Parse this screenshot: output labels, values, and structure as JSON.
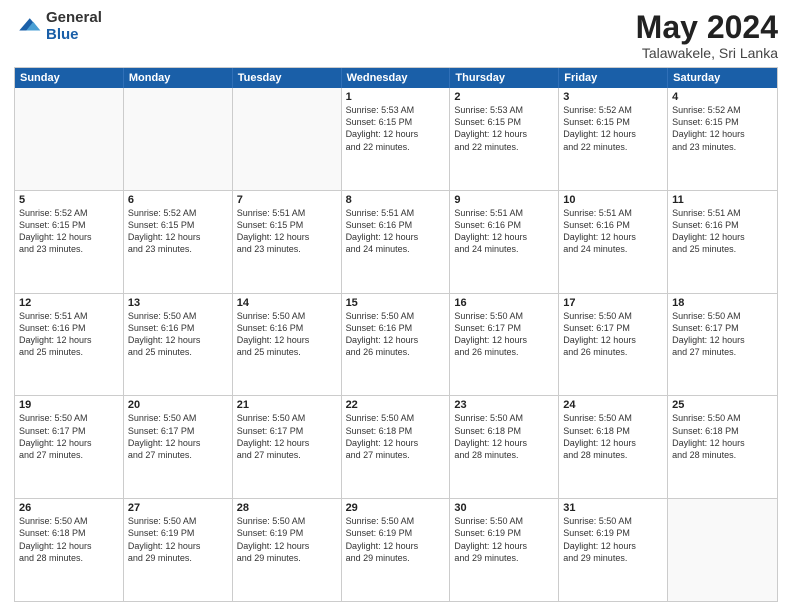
{
  "logo": {
    "general": "General",
    "blue": "Blue"
  },
  "title": {
    "month": "May 2024",
    "location": "Talawakele, Sri Lanka"
  },
  "days": [
    "Sunday",
    "Monday",
    "Tuesday",
    "Wednesday",
    "Thursday",
    "Friday",
    "Saturday"
  ],
  "weeks": [
    [
      {
        "day": "",
        "info": ""
      },
      {
        "day": "",
        "info": ""
      },
      {
        "day": "",
        "info": ""
      },
      {
        "day": "1",
        "info": "Sunrise: 5:53 AM\nSunset: 6:15 PM\nDaylight: 12 hours\nand 22 minutes."
      },
      {
        "day": "2",
        "info": "Sunrise: 5:53 AM\nSunset: 6:15 PM\nDaylight: 12 hours\nand 22 minutes."
      },
      {
        "day": "3",
        "info": "Sunrise: 5:52 AM\nSunset: 6:15 PM\nDaylight: 12 hours\nand 22 minutes."
      },
      {
        "day": "4",
        "info": "Sunrise: 5:52 AM\nSunset: 6:15 PM\nDaylight: 12 hours\nand 23 minutes."
      }
    ],
    [
      {
        "day": "5",
        "info": "Sunrise: 5:52 AM\nSunset: 6:15 PM\nDaylight: 12 hours\nand 23 minutes."
      },
      {
        "day": "6",
        "info": "Sunrise: 5:52 AM\nSunset: 6:15 PM\nDaylight: 12 hours\nand 23 minutes."
      },
      {
        "day": "7",
        "info": "Sunrise: 5:51 AM\nSunset: 6:15 PM\nDaylight: 12 hours\nand 23 minutes."
      },
      {
        "day": "8",
        "info": "Sunrise: 5:51 AM\nSunset: 6:16 PM\nDaylight: 12 hours\nand 24 minutes."
      },
      {
        "day": "9",
        "info": "Sunrise: 5:51 AM\nSunset: 6:16 PM\nDaylight: 12 hours\nand 24 minutes."
      },
      {
        "day": "10",
        "info": "Sunrise: 5:51 AM\nSunset: 6:16 PM\nDaylight: 12 hours\nand 24 minutes."
      },
      {
        "day": "11",
        "info": "Sunrise: 5:51 AM\nSunset: 6:16 PM\nDaylight: 12 hours\nand 25 minutes."
      }
    ],
    [
      {
        "day": "12",
        "info": "Sunrise: 5:51 AM\nSunset: 6:16 PM\nDaylight: 12 hours\nand 25 minutes."
      },
      {
        "day": "13",
        "info": "Sunrise: 5:50 AM\nSunset: 6:16 PM\nDaylight: 12 hours\nand 25 minutes."
      },
      {
        "day": "14",
        "info": "Sunrise: 5:50 AM\nSunset: 6:16 PM\nDaylight: 12 hours\nand 25 minutes."
      },
      {
        "day": "15",
        "info": "Sunrise: 5:50 AM\nSunset: 6:16 PM\nDaylight: 12 hours\nand 26 minutes."
      },
      {
        "day": "16",
        "info": "Sunrise: 5:50 AM\nSunset: 6:17 PM\nDaylight: 12 hours\nand 26 minutes."
      },
      {
        "day": "17",
        "info": "Sunrise: 5:50 AM\nSunset: 6:17 PM\nDaylight: 12 hours\nand 26 minutes."
      },
      {
        "day": "18",
        "info": "Sunrise: 5:50 AM\nSunset: 6:17 PM\nDaylight: 12 hours\nand 27 minutes."
      }
    ],
    [
      {
        "day": "19",
        "info": "Sunrise: 5:50 AM\nSunset: 6:17 PM\nDaylight: 12 hours\nand 27 minutes."
      },
      {
        "day": "20",
        "info": "Sunrise: 5:50 AM\nSunset: 6:17 PM\nDaylight: 12 hours\nand 27 minutes."
      },
      {
        "day": "21",
        "info": "Sunrise: 5:50 AM\nSunset: 6:17 PM\nDaylight: 12 hours\nand 27 minutes."
      },
      {
        "day": "22",
        "info": "Sunrise: 5:50 AM\nSunset: 6:18 PM\nDaylight: 12 hours\nand 27 minutes."
      },
      {
        "day": "23",
        "info": "Sunrise: 5:50 AM\nSunset: 6:18 PM\nDaylight: 12 hours\nand 28 minutes."
      },
      {
        "day": "24",
        "info": "Sunrise: 5:50 AM\nSunset: 6:18 PM\nDaylight: 12 hours\nand 28 minutes."
      },
      {
        "day": "25",
        "info": "Sunrise: 5:50 AM\nSunset: 6:18 PM\nDaylight: 12 hours\nand 28 minutes."
      }
    ],
    [
      {
        "day": "26",
        "info": "Sunrise: 5:50 AM\nSunset: 6:18 PM\nDaylight: 12 hours\nand 28 minutes."
      },
      {
        "day": "27",
        "info": "Sunrise: 5:50 AM\nSunset: 6:19 PM\nDaylight: 12 hours\nand 29 minutes."
      },
      {
        "day": "28",
        "info": "Sunrise: 5:50 AM\nSunset: 6:19 PM\nDaylight: 12 hours\nand 29 minutes."
      },
      {
        "day": "29",
        "info": "Sunrise: 5:50 AM\nSunset: 6:19 PM\nDaylight: 12 hours\nand 29 minutes."
      },
      {
        "day": "30",
        "info": "Sunrise: 5:50 AM\nSunset: 6:19 PM\nDaylight: 12 hours\nand 29 minutes."
      },
      {
        "day": "31",
        "info": "Sunrise: 5:50 AM\nSunset: 6:19 PM\nDaylight: 12 hours\nand 29 minutes."
      },
      {
        "day": "",
        "info": ""
      }
    ]
  ]
}
